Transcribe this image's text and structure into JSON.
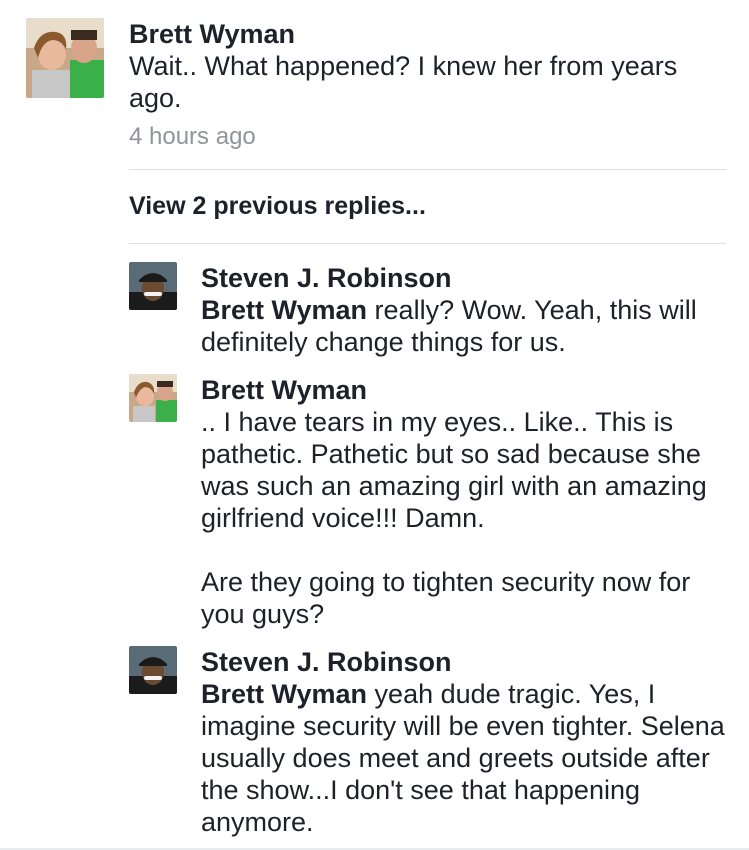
{
  "top_comment": {
    "author": "Brett Wyman",
    "text": "Wait.. What happened? I knew her from years ago.",
    "timestamp": "4 hours ago",
    "avatar_icon": "couple-photo-avatar"
  },
  "view_replies": "View 2 previous replies...",
  "replies": [
    {
      "author": "Steven J. Robinson",
      "mention": "Brett Wyman",
      "text": " really? Wow. Yeah, this will definitely change things for us.",
      "avatar_icon": "man-with-cap-avatar"
    },
    {
      "author": "Brett Wyman",
      "mention": "",
      "text": ".. I have tears in my eyes.. Like.. This is pathetic. Pathetic but so sad because she was such an amazing girl with an amazing girlfriend voice!!! Damn.\n\nAre they going to tighten security now for you guys?",
      "avatar_icon": "couple-photo-avatar"
    },
    {
      "author": "Steven J. Robinson",
      "mention": "Brett Wyman",
      "text": " yeah dude tragic. Yes, I imagine security will be even tighter. Selena usually does meet and greets outside after the show...I don't see that happening anymore.",
      "avatar_icon": "man-with-cap-avatar"
    }
  ],
  "colors": {
    "text": "#1d2129",
    "timestamp": "#90949c",
    "divider": "#dddfe2"
  }
}
